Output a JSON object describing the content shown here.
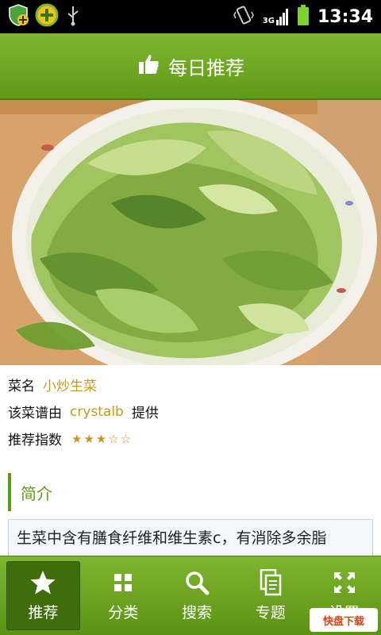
{
  "status_bar": {
    "time": "13:34",
    "network": "3G"
  },
  "header": {
    "title": "每日推荐"
  },
  "dish": {
    "name_label": "菜名",
    "name": "小炒生菜",
    "provider_label": "该菜谱由",
    "provider": "crystalb",
    "provider_suffix": "提供",
    "rating_label": "推荐指数",
    "rating_text": "★★★☆☆",
    "rating": 3,
    "rating_max": 5
  },
  "intro": {
    "title": "简介",
    "text": "生菜中含有膳食纤维和维生素c，有消除多余脂"
  },
  "nav": [
    {
      "label": "推荐",
      "icon": "star-icon",
      "active": true
    },
    {
      "label": "分类",
      "icon": "grid-icon",
      "active": false
    },
    {
      "label": "搜索",
      "icon": "search-icon",
      "active": false
    },
    {
      "label": "专题",
      "icon": "document-icon",
      "active": false
    },
    {
      "label": "设置",
      "icon": "expand-arrows-icon",
      "active": false
    }
  ],
  "watermark": {
    "text": "快盘下载"
  },
  "colors": {
    "header_green": "#6aa622",
    "accent_gold": "#c89a1a",
    "nav_active": "#3f6d0e"
  }
}
